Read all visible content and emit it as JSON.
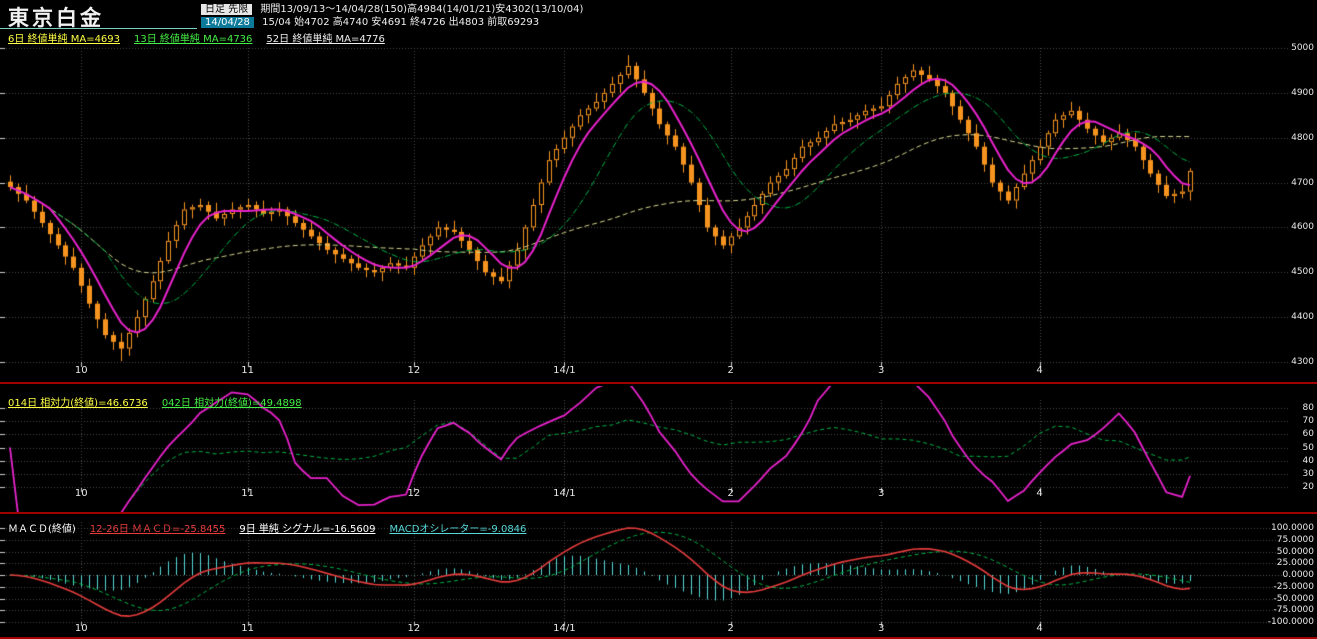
{
  "header": {
    "title": "東京白金",
    "row1_chip": "日足 先限",
    "row1_text": "期間13/09/13～14/04/28(150)高4984(14/01/21)安4302(13/10/04)",
    "row2_chip": "14/04/28",
    "row2_text": "15/04 始4702 高4740 安4691 終4726 出4803 前取69293",
    "ma_legend": [
      {
        "label": "6日 終値単純 MA=4693",
        "color": "#ffff44"
      },
      {
        "label": "13日 終値単純 MA=4736",
        "color": "#44ee44"
      },
      {
        "label": "52日 終値単純 MA=4776",
        "color": "#eeeeee"
      }
    ]
  },
  "colors": {
    "background": "#000000",
    "candle": "#f79420",
    "ma6": "#e822cc",
    "ma13": "#00b347",
    "ma52": "#d8d890",
    "rsi14": "#e822cc",
    "rsi42": "#00b347",
    "macd_line": "#e63c3c",
    "macd_signal": "#00b347",
    "macd_hist": "#57d9d9",
    "grid": "#4a4a4a",
    "tick": "#cfcfcf",
    "separator": "#a00000",
    "axis_text": "#e8e8e8"
  },
  "chart_data": {
    "type": "candlestick+indicators",
    "title": "東京白金 日足 先限",
    "bars": 150,
    "date_range": "13/09/13～14/04/28",
    "x_ticks": [
      {
        "i": 9,
        "label": "10"
      },
      {
        "i": 30,
        "label": "11"
      },
      {
        "i": 51,
        "label": "12"
      },
      {
        "i": 70,
        "label": "14/1"
      },
      {
        "i": 91,
        "label": "2"
      },
      {
        "i": 110,
        "label": "3"
      },
      {
        "i": 130,
        "label": "4"
      }
    ],
    "main": {
      "ylim": [
        4300,
        5000
      ],
      "y_ticks": [
        5000,
        4900,
        4800,
        4700,
        4600,
        4500,
        4400,
        4300
      ],
      "ma_periods": [
        6,
        13,
        52
      ],
      "high_extreme": {
        "index": 78,
        "value": 4984
      },
      "low_extreme": {
        "index": 14,
        "value": 4302
      },
      "closes": [
        4690,
        4675,
        4660,
        4635,
        4610,
        4585,
        4560,
        4535,
        4510,
        4470,
        4430,
        4395,
        4360,
        4345,
        4330,
        4365,
        4400,
        4440,
        4480,
        4525,
        4570,
        4605,
        4640,
        4645,
        4650,
        4635,
        4620,
        4630,
        4640,
        4645,
        4650,
        4640,
        4630,
        4635,
        4640,
        4625,
        4610,
        4595,
        4580,
        4565,
        4550,
        4540,
        4530,
        4520,
        4510,
        4505,
        4500,
        4510,
        4520,
        4515,
        4510,
        4535,
        4560,
        4580,
        4600,
        4595,
        4590,
        4570,
        4550,
        4525,
        4500,
        4490,
        4480,
        4515,
        4550,
        4600,
        4650,
        4700,
        4750,
        4775,
        4800,
        4825,
        4850,
        4865,
        4880,
        4900,
        4920,
        4940,
        4960,
        4930,
        4900,
        4865,
        4830,
        4805,
        4780,
        4740,
        4700,
        4650,
        4600,
        4580,
        4560,
        4580,
        4600,
        4625,
        4650,
        4675,
        4700,
        4715,
        4730,
        4755,
        4780,
        4790,
        4800,
        4815,
        4830,
        4835,
        4840,
        4850,
        4860,
        4865,
        4870,
        4895,
        4920,
        4935,
        4950,
        4940,
        4930,
        4915,
        4900,
        4870,
        4840,
        4810,
        4780,
        4740,
        4700,
        4680,
        4660,
        4690,
        4720,
        4750,
        4780,
        4810,
        4840,
        4850,
        4860,
        4840,
        4820,
        4805,
        4790,
        4800,
        4810,
        4795,
        4780,
        4750,
        4720,
        4695,
        4670,
        4675,
        4680,
        4726
      ]
    },
    "rsi": {
      "periods": [
        14,
        42
      ],
      "ylim": [
        15,
        85
      ],
      "y_ticks": [
        80,
        70,
        60,
        50,
        40,
        30,
        20
      ],
      "legend": [
        {
          "label": "014日 相対力(終値)=46.6736",
          "color": "#ffff44"
        },
        {
          "label": "042日 相対力(終値)=49.4898",
          "color": "#44ee44"
        }
      ]
    },
    "macd": {
      "fast": 12,
      "slow": 26,
      "signal": 9,
      "ylim": [
        -100,
        100
      ],
      "y_ticks": [
        {
          "v": 100,
          "label": "100.0000"
        },
        {
          "v": 75,
          "label": "75.0000"
        },
        {
          "v": 50,
          "label": "50.0000"
        },
        {
          "v": 25,
          "label": "25.0000"
        },
        {
          "v": 0,
          "label": "0.0000"
        },
        {
          "v": -25,
          "label": "-25.0000"
        },
        {
          "v": -50,
          "label": "-50.0000"
        },
        {
          "v": -75,
          "label": "-75.0000"
        },
        {
          "v": -100,
          "label": "-100.0000"
        }
      ],
      "legend": [
        {
          "label": "ＭＡＣＤ(終値)",
          "color": "#ffffff",
          "underline": false
        },
        {
          "label": "12-26日 ＭＡＣＤ=-25.8455",
          "color": "#e63c3c"
        },
        {
          "label": "9日 単純 シグナル=-16.5609",
          "color": "#ffffff"
        },
        {
          "label": "MACDオシレーター=-9.0846",
          "color": "#57d9d9"
        }
      ]
    }
  }
}
